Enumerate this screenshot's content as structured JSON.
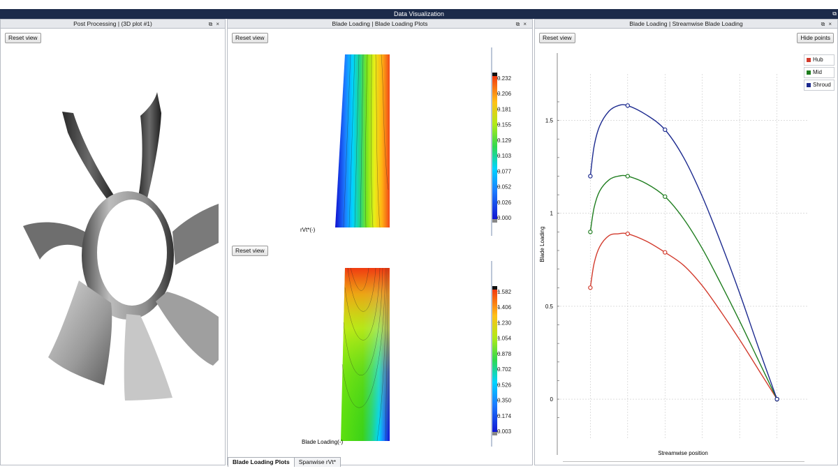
{
  "window": {
    "title": "Data Visualization",
    "float_icon": "⧉"
  },
  "panels": {
    "left": {
      "title": "Post Processing | (3D plot #1)",
      "reset_label": "Reset view"
    },
    "middle": {
      "title": "Blade Loading | Blade Loading Plots",
      "reset_label_top": "Reset view",
      "reset_label_bottom": "Reset view",
      "top_plot": {
        "axis_label": "rVt*(-)",
        "colorbar": [
          "0.232",
          "0.206",
          "0.181",
          "0.155",
          "0.129",
          "0.103",
          "0.077",
          "0.052",
          "0.026",
          "0.000"
        ]
      },
      "bottom_plot": {
        "axis_label": "Blade Loading(-)",
        "colorbar": [
          "1.582",
          "1.406",
          "1.230",
          "1.054",
          "0.878",
          "0.702",
          "0.526",
          "0.350",
          "0.174",
          "0.003"
        ]
      },
      "tabs": [
        "Blade Loading Plots",
        "Spanwise rVt*"
      ]
    },
    "right": {
      "title": "Blade Loading | Streamwise Blade Loading",
      "reset_label": "Reset view",
      "hide_points_label": "Hide points"
    }
  },
  "icons": {
    "float": "float-window-icon",
    "close": "close-icon"
  },
  "colors": {
    "hub": "#d23a2c",
    "mid": "#1e7d1e",
    "shroud": "#1c2a8f",
    "titlebar": "#1c2b4a"
  },
  "chart_data": {
    "type": "line",
    "xlabel": "Streamwise position",
    "ylabel": "Blade Loading",
    "xlim": [
      -0.05,
      1.05
    ],
    "ylim": [
      -0.15,
      1.75
    ],
    "xticks": [
      "0",
      "0.2",
      "0.4",
      "0.6",
      "0.8",
      "1"
    ],
    "yticks": [
      "0",
      "0.5",
      "1",
      "1.5"
    ],
    "grid": true,
    "legend_position": "top-right",
    "series": [
      {
        "name": "Hub",
        "color": "#d23a2c",
        "points": [
          [
            0,
            0.6
          ],
          [
            0.2,
            0.89
          ],
          [
            0.4,
            0.79
          ],
          [
            1,
            0
          ]
        ],
        "x": [
          0,
          0.02,
          0.05,
          0.1,
          0.15,
          0.2,
          0.3,
          0.4,
          0.5,
          0.6,
          0.7,
          0.8,
          0.9,
          1.0
        ],
        "values": [
          0.6,
          0.73,
          0.82,
          0.88,
          0.89,
          0.89,
          0.85,
          0.79,
          0.72,
          0.61,
          0.47,
          0.32,
          0.16,
          0
        ]
      },
      {
        "name": "Mid",
        "color": "#1e7d1e",
        "points": [
          [
            0,
            0.9
          ],
          [
            0.2,
            1.2
          ],
          [
            0.4,
            1.09
          ],
          [
            1,
            0
          ]
        ],
        "x": [
          0,
          0.02,
          0.05,
          0.1,
          0.15,
          0.2,
          0.3,
          0.4,
          0.5,
          0.6,
          0.7,
          0.8,
          0.9,
          1.0
        ],
        "values": [
          0.9,
          1.03,
          1.12,
          1.18,
          1.2,
          1.2,
          1.16,
          1.09,
          0.97,
          0.81,
          0.62,
          0.42,
          0.21,
          0
        ]
      },
      {
        "name": "Shroud",
        "color": "#1c2a8f",
        "points": [
          [
            0,
            1.2
          ],
          [
            0.2,
            1.58
          ],
          [
            0.4,
            1.45
          ],
          [
            1,
            0
          ]
        ],
        "x": [
          0,
          0.02,
          0.05,
          0.1,
          0.15,
          0.2,
          0.3,
          0.4,
          0.5,
          0.6,
          0.7,
          0.8,
          0.9,
          1.0
        ],
        "values": [
          1.2,
          1.36,
          1.47,
          1.55,
          1.58,
          1.58,
          1.53,
          1.45,
          1.3,
          1.09,
          0.84,
          0.57,
          0.28,
          0
        ]
      }
    ]
  }
}
